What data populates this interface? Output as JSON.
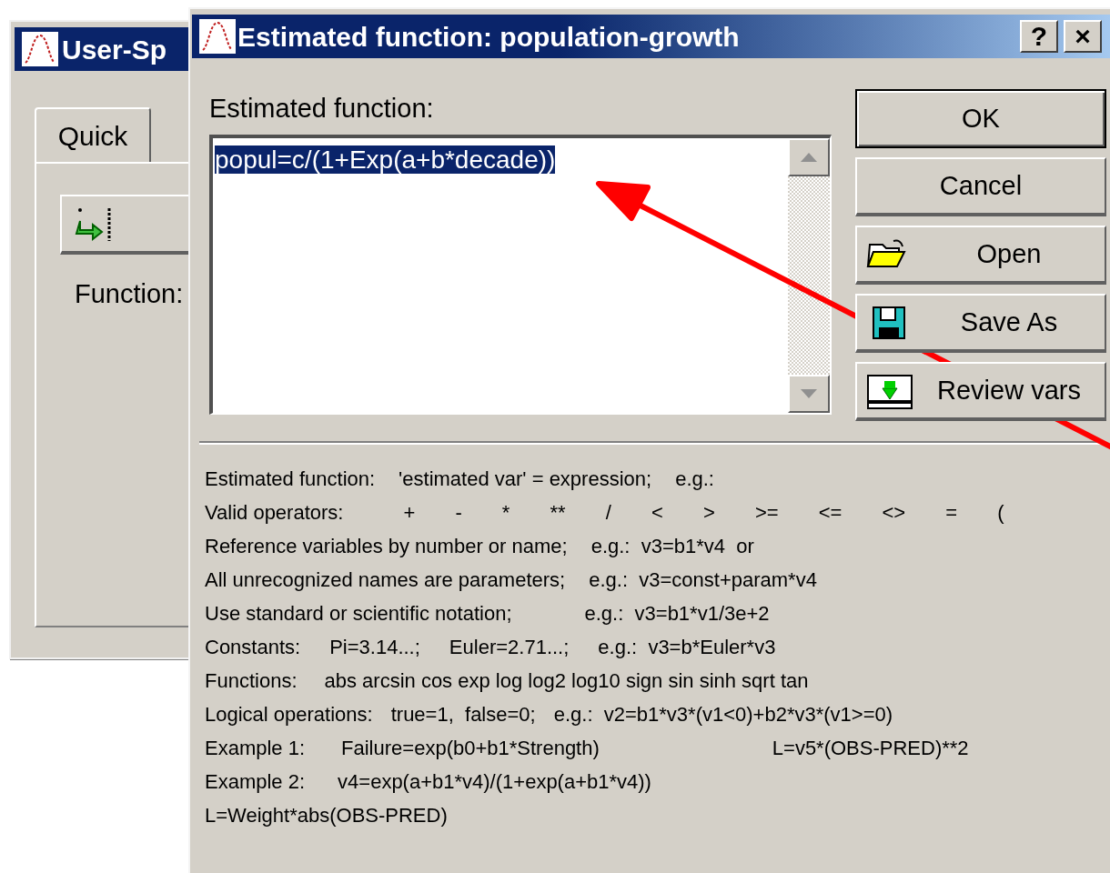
{
  "back_window": {
    "title": "User-Sp",
    "tabs": [
      {
        "label": "Quick",
        "selected": true
      }
    ],
    "function_label": "Function:"
  },
  "dialog": {
    "title": "Estimated function: population-growth",
    "title_buttons": [
      "?",
      "×"
    ],
    "field_label": "Estimated function:",
    "field": {
      "value": "popul=c/(1+Exp(a+b*decade))",
      "selected": true
    },
    "buttons": [
      {
        "label": "OK",
        "kind": "default"
      },
      {
        "label": "Cancel",
        "kind": "plain"
      },
      {
        "label": "Open",
        "kind": "open"
      },
      {
        "label": "Save As",
        "kind": "save"
      },
      {
        "label": "Review vars",
        "kind": "review"
      }
    ],
    "help_lines": [
      [
        "Estimated function:",
        "'estimated var' = expression;",
        "e.g.:"
      ],
      [
        "Valid operators:",
        "+ - * ** / < > >= <= <> = ("
      ],
      [
        "Reference variables by number or name;",
        "e.g.:  v3=b1*v4  or"
      ],
      [
        "All unrecognized names are parameters;",
        "e.g.:  v3=const+param*v4"
      ],
      [
        "Use standard or scientific notation;",
        "e.g.:  v3=b1*v1/3e+2"
      ],
      [
        "Constants:",
        "Pi=3.14...;",
        "Euler=2.71...;",
        "e.g.:  v3=b*Euler*v3"
      ],
      [
        "Functions:",
        "abs arcsin cos exp log log2 log10 sign sin sinh sqrt tan"
      ],
      [
        "Logical operations:",
        "true=1,  false=0;",
        "e.g.:  v2=b1*v3*(v1<0)+b2*v3*(v1>=0)"
      ],
      [
        "Example 1:",
        "Failure=exp(b0+b1*Strength)",
        "L=v5*(OBS-PRED)**2"
      ],
      [
        "Example 2:",
        "v4=exp(a+b1*v4)/(1+exp(a+b1*v4))"
      ],
      [
        "L=Weight*abs(OBS-PRED)"
      ]
    ]
  }
}
